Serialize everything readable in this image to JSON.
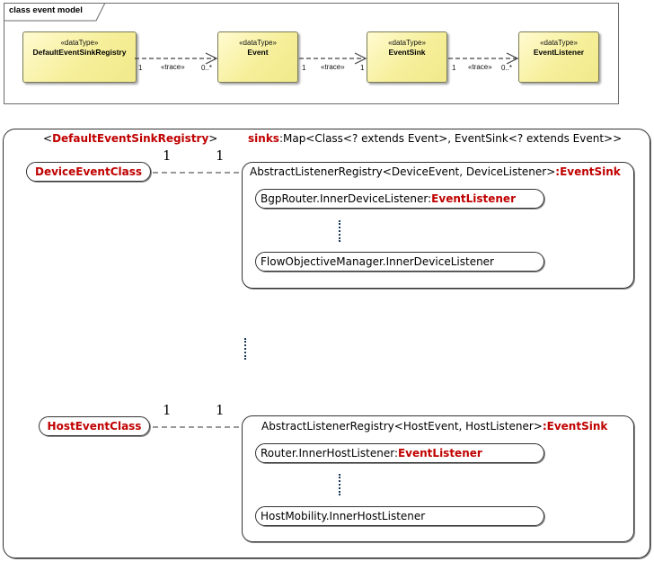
{
  "uml": {
    "frame_title": "class event model",
    "classes": [
      {
        "stereotype": "«dataType»",
        "name": "DefaultEventSinkRegistry"
      },
      {
        "stereotype": "«dataType»",
        "name": "Event"
      },
      {
        "stereotype": "«dataType»",
        "name": "EventSink"
      },
      {
        "stereotype": "«dataType»",
        "name": "EventListener"
      }
    ],
    "associations": [
      {
        "label": "«trace»",
        "source_mult": "1",
        "target_mult": "0..*"
      },
      {
        "label": "«trace»",
        "source_mult": "1",
        "target_mult": "1"
      },
      {
        "label": "«trace»",
        "source_mult": "1",
        "target_mult": "0..*"
      }
    ]
  },
  "registry": {
    "header": {
      "open": "<",
      "owner": "DefaultEventSinkRegistry",
      "close": ">",
      "field_name": "sinks",
      "field_type": ":Map<Class<? extends Event>, EventSink<? extends Event>>"
    },
    "vertical_ellipsis": "⋮",
    "entries": [
      {
        "key": "DeviceEventClass",
        "mult_left": "1",
        "mult_right": "1",
        "sink_prefix": "AbstractListenerRegistry<DeviceEvent, DeviceListener>",
        "sink_suffix": ":EventSink",
        "listeners": [
          {
            "prefix": "BgpRouter.InnerDeviceListener:",
            "suffix": "EventListener"
          },
          {
            "prefix": "FlowObjectiveManager.InnerDeviceListener",
            "suffix": ""
          }
        ]
      },
      {
        "key": "HostEventClass",
        "mult_left": "1",
        "mult_right": "1",
        "sink_prefix": "AbstractListenerRegistry<HostEvent, HostListener>",
        "sink_suffix": ":EventSink",
        "listeners": [
          {
            "prefix": "Router.InnerHostListener:",
            "suffix": "EventListener"
          },
          {
            "prefix": "HostMobility.InnerHostListener",
            "suffix": ""
          }
        ]
      }
    ]
  },
  "colors": {
    "accent_red": "#c00000",
    "class_fill": "#f6ef9a",
    "border": "#333333"
  }
}
